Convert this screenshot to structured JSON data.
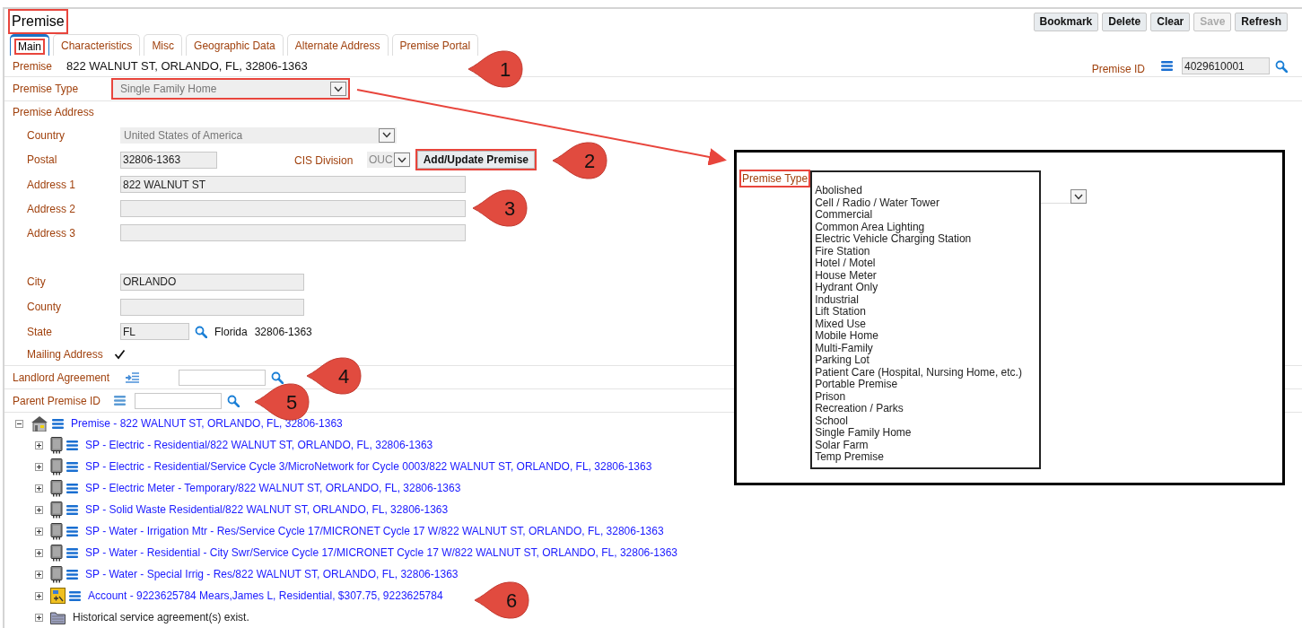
{
  "title": {
    "text": "Premise",
    "highlighted": true
  },
  "actions": [
    {
      "label": "Bookmark",
      "disabled": false
    },
    {
      "label": "Delete",
      "disabled": false
    },
    {
      "label": "Clear",
      "disabled": false
    },
    {
      "label": "Save",
      "disabled": true
    },
    {
      "label": "Refresh",
      "disabled": false
    }
  ],
  "tabs": [
    {
      "label": "Main",
      "selected": true,
      "highlighted": true
    },
    {
      "label": "Characteristics",
      "selected": false,
      "highlighted": false
    },
    {
      "label": "Misc",
      "selected": false,
      "highlighted": false
    },
    {
      "label": "Geographic Data",
      "selected": false,
      "highlighted": false
    },
    {
      "label": "Alternate Address",
      "selected": false,
      "highlighted": false
    },
    {
      "label": "Premise Portal",
      "selected": false,
      "highlighted": false
    }
  ],
  "premise": {
    "label": "Premise",
    "value": "822 WALNUT ST, ORLANDO, FL, 32806-1363"
  },
  "premise_id": {
    "label": "Premise ID",
    "value": "4029610001"
  },
  "premise_type": {
    "label": "Premise Type",
    "value": "Single Family Home",
    "highlighted": true
  },
  "premise_address": {
    "label": "Premise Address",
    "country": {
      "label": "Country",
      "value": "United States of America"
    },
    "postal": {
      "label": "Postal",
      "value": "32806-1363"
    },
    "cis_division": {
      "label": "CIS Division",
      "value": "OUC"
    },
    "add_update_button": {
      "label": "Add/Update Premise",
      "highlighted": true
    },
    "address_1": {
      "label": "Address 1",
      "value": "822 WALNUT ST"
    },
    "address_2": {
      "label": "Address 2"
    },
    "address_3": {
      "label": "Address 3"
    },
    "city": {
      "label": "City",
      "value": "ORLANDO"
    },
    "county": {
      "label": "County"
    },
    "state": {
      "label": "State",
      "value": "FL",
      "name": "Florida",
      "postal": "32806-1363"
    },
    "mailing_address": {
      "label": "Mailing Address",
      "checked": true
    }
  },
  "landlord_agreement": {
    "label": "Landlord Agreement"
  },
  "parent_premise_id": {
    "label": "Parent Premise ID"
  },
  "tree": [
    {
      "kind": "premise",
      "text": "Premise - 822 WALNUT ST, ORLANDO, FL, 32806-1363",
      "expanded": true,
      "children": [
        {
          "kind": "service_point",
          "text": "SP - Electric - Residential/822 WALNUT ST, ORLANDO, FL, 32806-1363",
          "expanded": false
        },
        {
          "kind": "service_point",
          "text": "SP - Electric - Residential/Service Cycle 3/MicroNetwork for Cycle 0003/822 WALNUT ST, ORLANDO, FL, 32806-1363",
          "expanded": false
        },
        {
          "kind": "service_point",
          "text": "SP - Electric Meter - Temporary/822 WALNUT ST, ORLANDO, FL, 32806-1363",
          "expanded": false
        },
        {
          "kind": "service_point",
          "text": "SP - Solid Waste Residential/822 WALNUT ST, ORLANDO, FL, 32806-1363",
          "expanded": false
        },
        {
          "kind": "service_point",
          "text": "SP - Water - Irrigation Mtr - Res/Service Cycle 17/MICRONET Cycle 17 W/822 WALNUT ST, ORLANDO, FL, 32806-1363",
          "expanded": false
        },
        {
          "kind": "service_point",
          "text": "SP - Water - Residential - City Swr/Service Cycle 17/MICRONET Cycle 17 W/822 WALNUT ST, ORLANDO, FL, 32806-1363",
          "expanded": false
        },
        {
          "kind": "service_point",
          "text": "SP - Water - Special Irrig - Res/822 WALNUT ST, ORLANDO, FL, 32806-1363",
          "expanded": false
        },
        {
          "kind": "account",
          "text": "Account - 9223625784 Mears,James L, Residential, $307.75, 9223625784",
          "expanded": false
        },
        {
          "kind": "history",
          "text": "Historical service agreement(s) exist.",
          "expanded": false
        }
      ]
    }
  ],
  "inset": {
    "label": "Premise Type",
    "highlighted": true,
    "options": [
      "Abolished",
      "Cell / Radio / Water Tower",
      "Commercial",
      "Common Area Lighting",
      "Electric Vehicle Charging Station",
      "Fire Station",
      "Hotel / Motel",
      "House Meter",
      "Hydrant Only",
      "Industrial",
      "Lift Station",
      "Mixed Use",
      "Mobile Home",
      "Multi-Family",
      "Parking Lot",
      "Patient Care (Hospital, Nursing Home, etc.)",
      "Portable Premise",
      "Prison",
      "Recreation / Parks",
      "School",
      "Single Family Home",
      "Solar Farm",
      "Temp Premise"
    ]
  },
  "callouts": [
    "1",
    "2",
    "3",
    "4",
    "5",
    "6"
  ]
}
